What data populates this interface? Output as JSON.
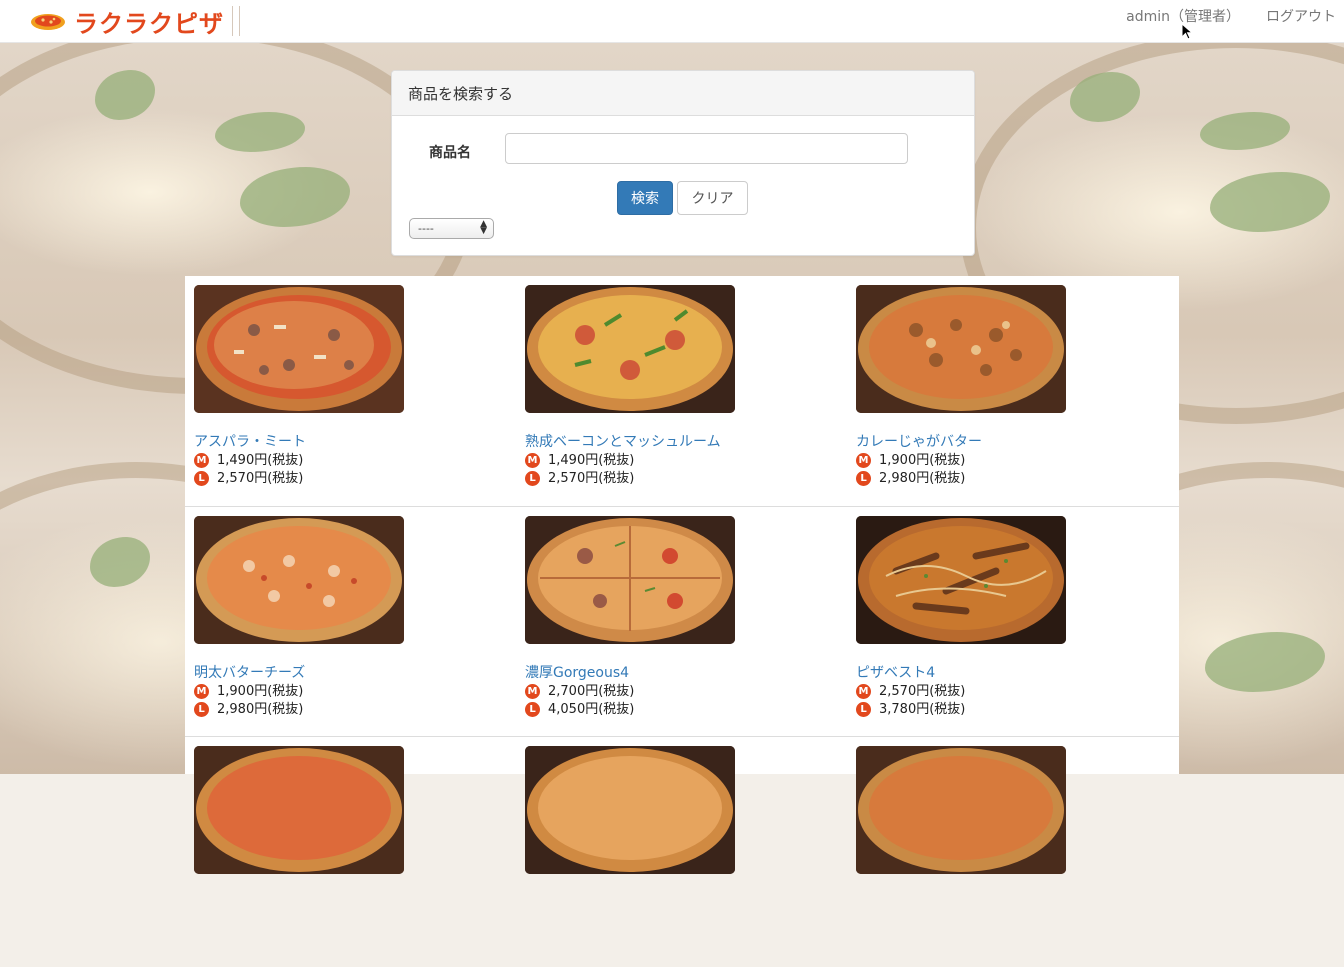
{
  "header": {
    "brand": "ラクラクピザ",
    "user": "admin（管理者）",
    "logout": "ログアウト"
  },
  "search": {
    "title": "商品を検索する",
    "name_label": "商品名",
    "name_value": "",
    "name_placeholder": "",
    "search_button": "検索",
    "clear_button": "クリア",
    "sort_selected": "----"
  },
  "products": [
    {
      "name": "アスパラ・ミート",
      "m_price": "1,490円(税抜)",
      "l_price": "2,570円(税抜)"
    },
    {
      "name": "熟成ベーコンとマッシュルーム",
      "m_price": "1,490円(税抜)",
      "l_price": "2,570円(税抜)"
    },
    {
      "name": "カレーじゃがバター",
      "m_price": "1,900円(税抜)",
      "l_price": "2,980円(税抜)"
    },
    {
      "name": "明太バターチーズ",
      "m_price": "1,900円(税抜)",
      "l_price": "2,980円(税抜)"
    },
    {
      "name": "濃厚Gorgeous4",
      "m_price": "2,700円(税抜)",
      "l_price": "4,050円(税抜)"
    },
    {
      "name": "ピザベスト4",
      "m_price": "2,570円(税抜)",
      "l_price": "3,780円(税抜)"
    }
  ],
  "size_badges": {
    "m": "M",
    "l": "L"
  },
  "colors": {
    "accent": "#e2481d",
    "link": "#337ab7",
    "primary_button": "#337ab7"
  }
}
